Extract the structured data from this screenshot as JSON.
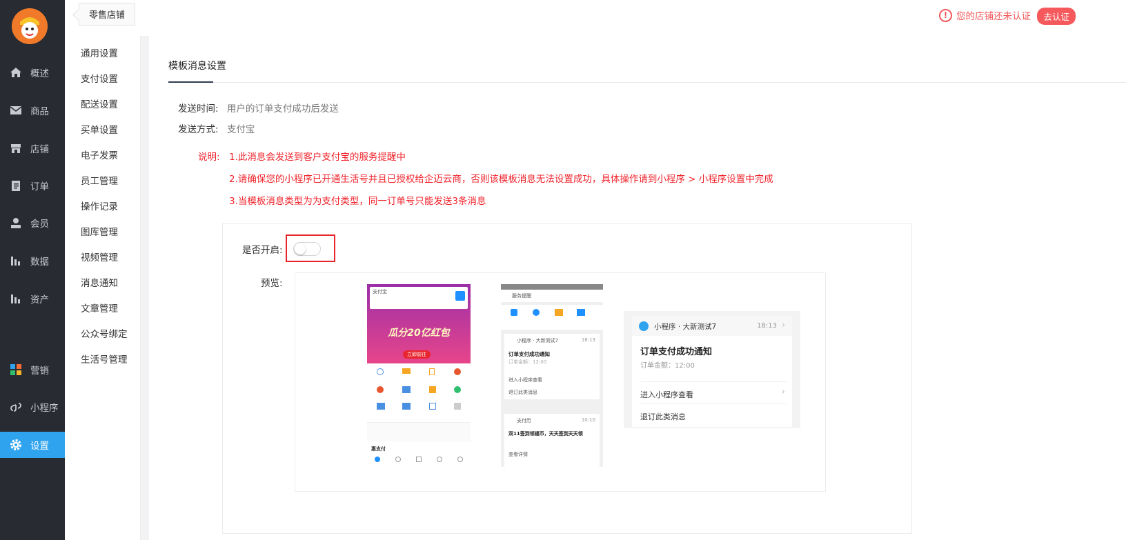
{
  "nav": {
    "items": [
      {
        "label": "概述",
        "icon": "home-icon"
      },
      {
        "label": "商品",
        "icon": "mail-icon"
      },
      {
        "label": "店铺",
        "icon": "store-icon"
      },
      {
        "label": "订单",
        "icon": "clipboard-icon"
      },
      {
        "label": "会员",
        "icon": "user-icon"
      },
      {
        "label": "数据",
        "icon": "bar-chart-icon"
      },
      {
        "label": "资产",
        "icon": "bar-chart-icon"
      },
      {
        "label": "营销",
        "icon": "apps-icon"
      },
      {
        "label": "小程序",
        "icon": "link-icon"
      },
      {
        "label": "设置",
        "icon": "gear-icon",
        "active": true
      }
    ]
  },
  "topbar": {
    "store_name": "零售店铺",
    "cert_warning": "您的店铺还未认证",
    "cert_button": "去认证"
  },
  "submenu": {
    "items": [
      "通用设置",
      "支付设置",
      "配送设置",
      "买单设置",
      "电子发票",
      "员工管理",
      "操作记录",
      "图库管理",
      "视频管理",
      "消息通知",
      "文章管理",
      "公众号绑定",
      "生活号管理"
    ]
  },
  "main": {
    "tab": "模板消息设置",
    "send_time_label": "发送时间:",
    "send_time_value": "用户的订单支付成功后发送",
    "send_method_label": "发送方式:",
    "send_method_value": "支付宝",
    "note_label": "说明:",
    "notes": [
      "1.此消息会发送到客户支付宝的服务提醒中",
      "2.请确保您的小程序已开通生活号并且已授权给企迈云商，否则该模板消息无法设置成功，具体操作请到小程序 > 小程序设置中完成",
      "3.当模板消息类型为为支付类型，同一订单号只能发送3条消息"
    ],
    "enable_label": "是否开启:",
    "enable_state": false,
    "preview_label": "预览:"
  },
  "preview": {
    "phone1": {
      "app_name": "支付宝",
      "banner": "瓜分20亿红包",
      "banner_btn": "立即前往",
      "bottom_title": "惠支付"
    },
    "phone2": {
      "header": "服务提醒",
      "sender": "小程序 · 大新测试7",
      "time": "18:13",
      "title": "订单支付成功通知",
      "amount": "订单金额：12:00",
      "link": "进入小程序查看",
      "unsub": "退订此类消息",
      "item2_sender": "支付历",
      "item2_time": "10:10",
      "item2_title": "双11签到领福币，天天签到天天领",
      "item2_link": "查看详情"
    },
    "notice": {
      "sender": "小程序 · 大新测试7",
      "time": "18:13",
      "title": "订单支付成功通知",
      "amount": "订单金额：12:00",
      "link": "进入小程序查看",
      "unsub": "退订此类消息"
    }
  },
  "colors": {
    "nav_bg": "#292b33",
    "active": "#2fa3ee",
    "warning": "#f2585b",
    "red_text": "#f0242c"
  }
}
